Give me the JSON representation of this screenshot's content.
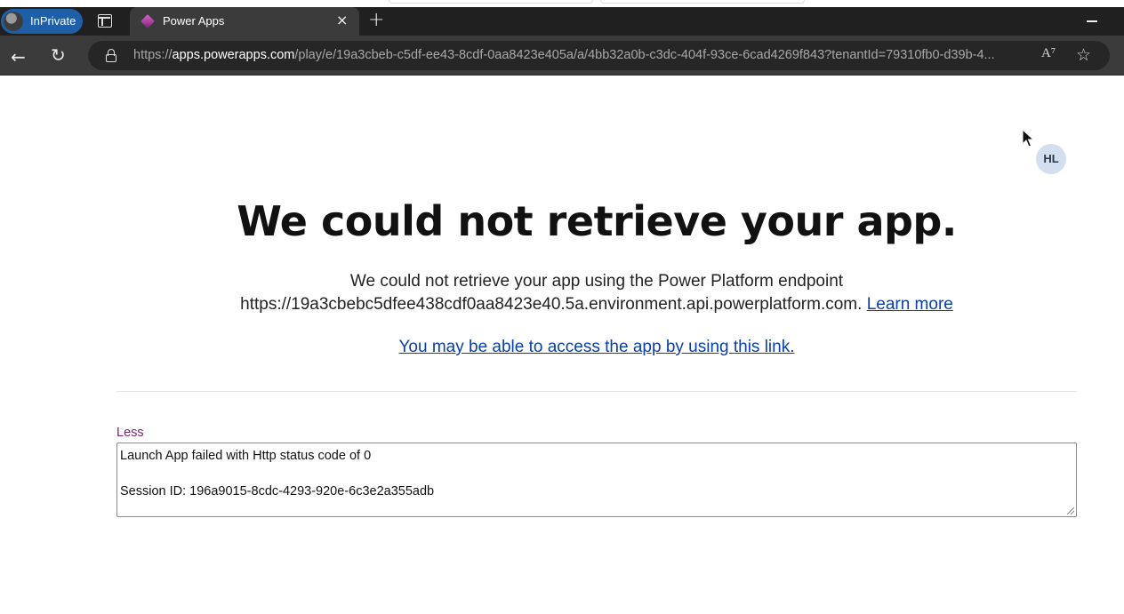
{
  "browser": {
    "inprivate_label": "InPrivate",
    "tab_title": "Power Apps",
    "close_glyph": "×",
    "new_tab_glyph": "+",
    "url_prefix": "https://",
    "url_host": "apps.powerapps.com",
    "url_rest": "/play/e/19a3cbeb-c5df-ee43-8cdf-0aa8423e405a/a/4bb32a0b-c3dc-404f-93ce-6cad4269f843?tenantId=79310fb0-d39b-4...",
    "read_aloud_glyph": "A⁷",
    "favorite_glyph": "☆",
    "back_glyph": "←",
    "reload_glyph": "↻"
  },
  "user": {
    "initials": "HL"
  },
  "error": {
    "heading": "We could not retrieve your app.",
    "desc_line1": "We could not retrieve your app using the Power Platform endpoint",
    "desc_line2": "https://19a3cbebc5dfee438cdf0aa8423e40.5a.environment.api.powerplatform.com.",
    "learn_more": "Learn more",
    "alt_link": "You may be able to access the app by using this link.",
    "toggle_label": "Less",
    "details_line1": "Launch App failed with Http status code of 0",
    "details_line2": "Session ID: 196a9015-8cdc-4293-920e-6c3e2a355adb"
  }
}
